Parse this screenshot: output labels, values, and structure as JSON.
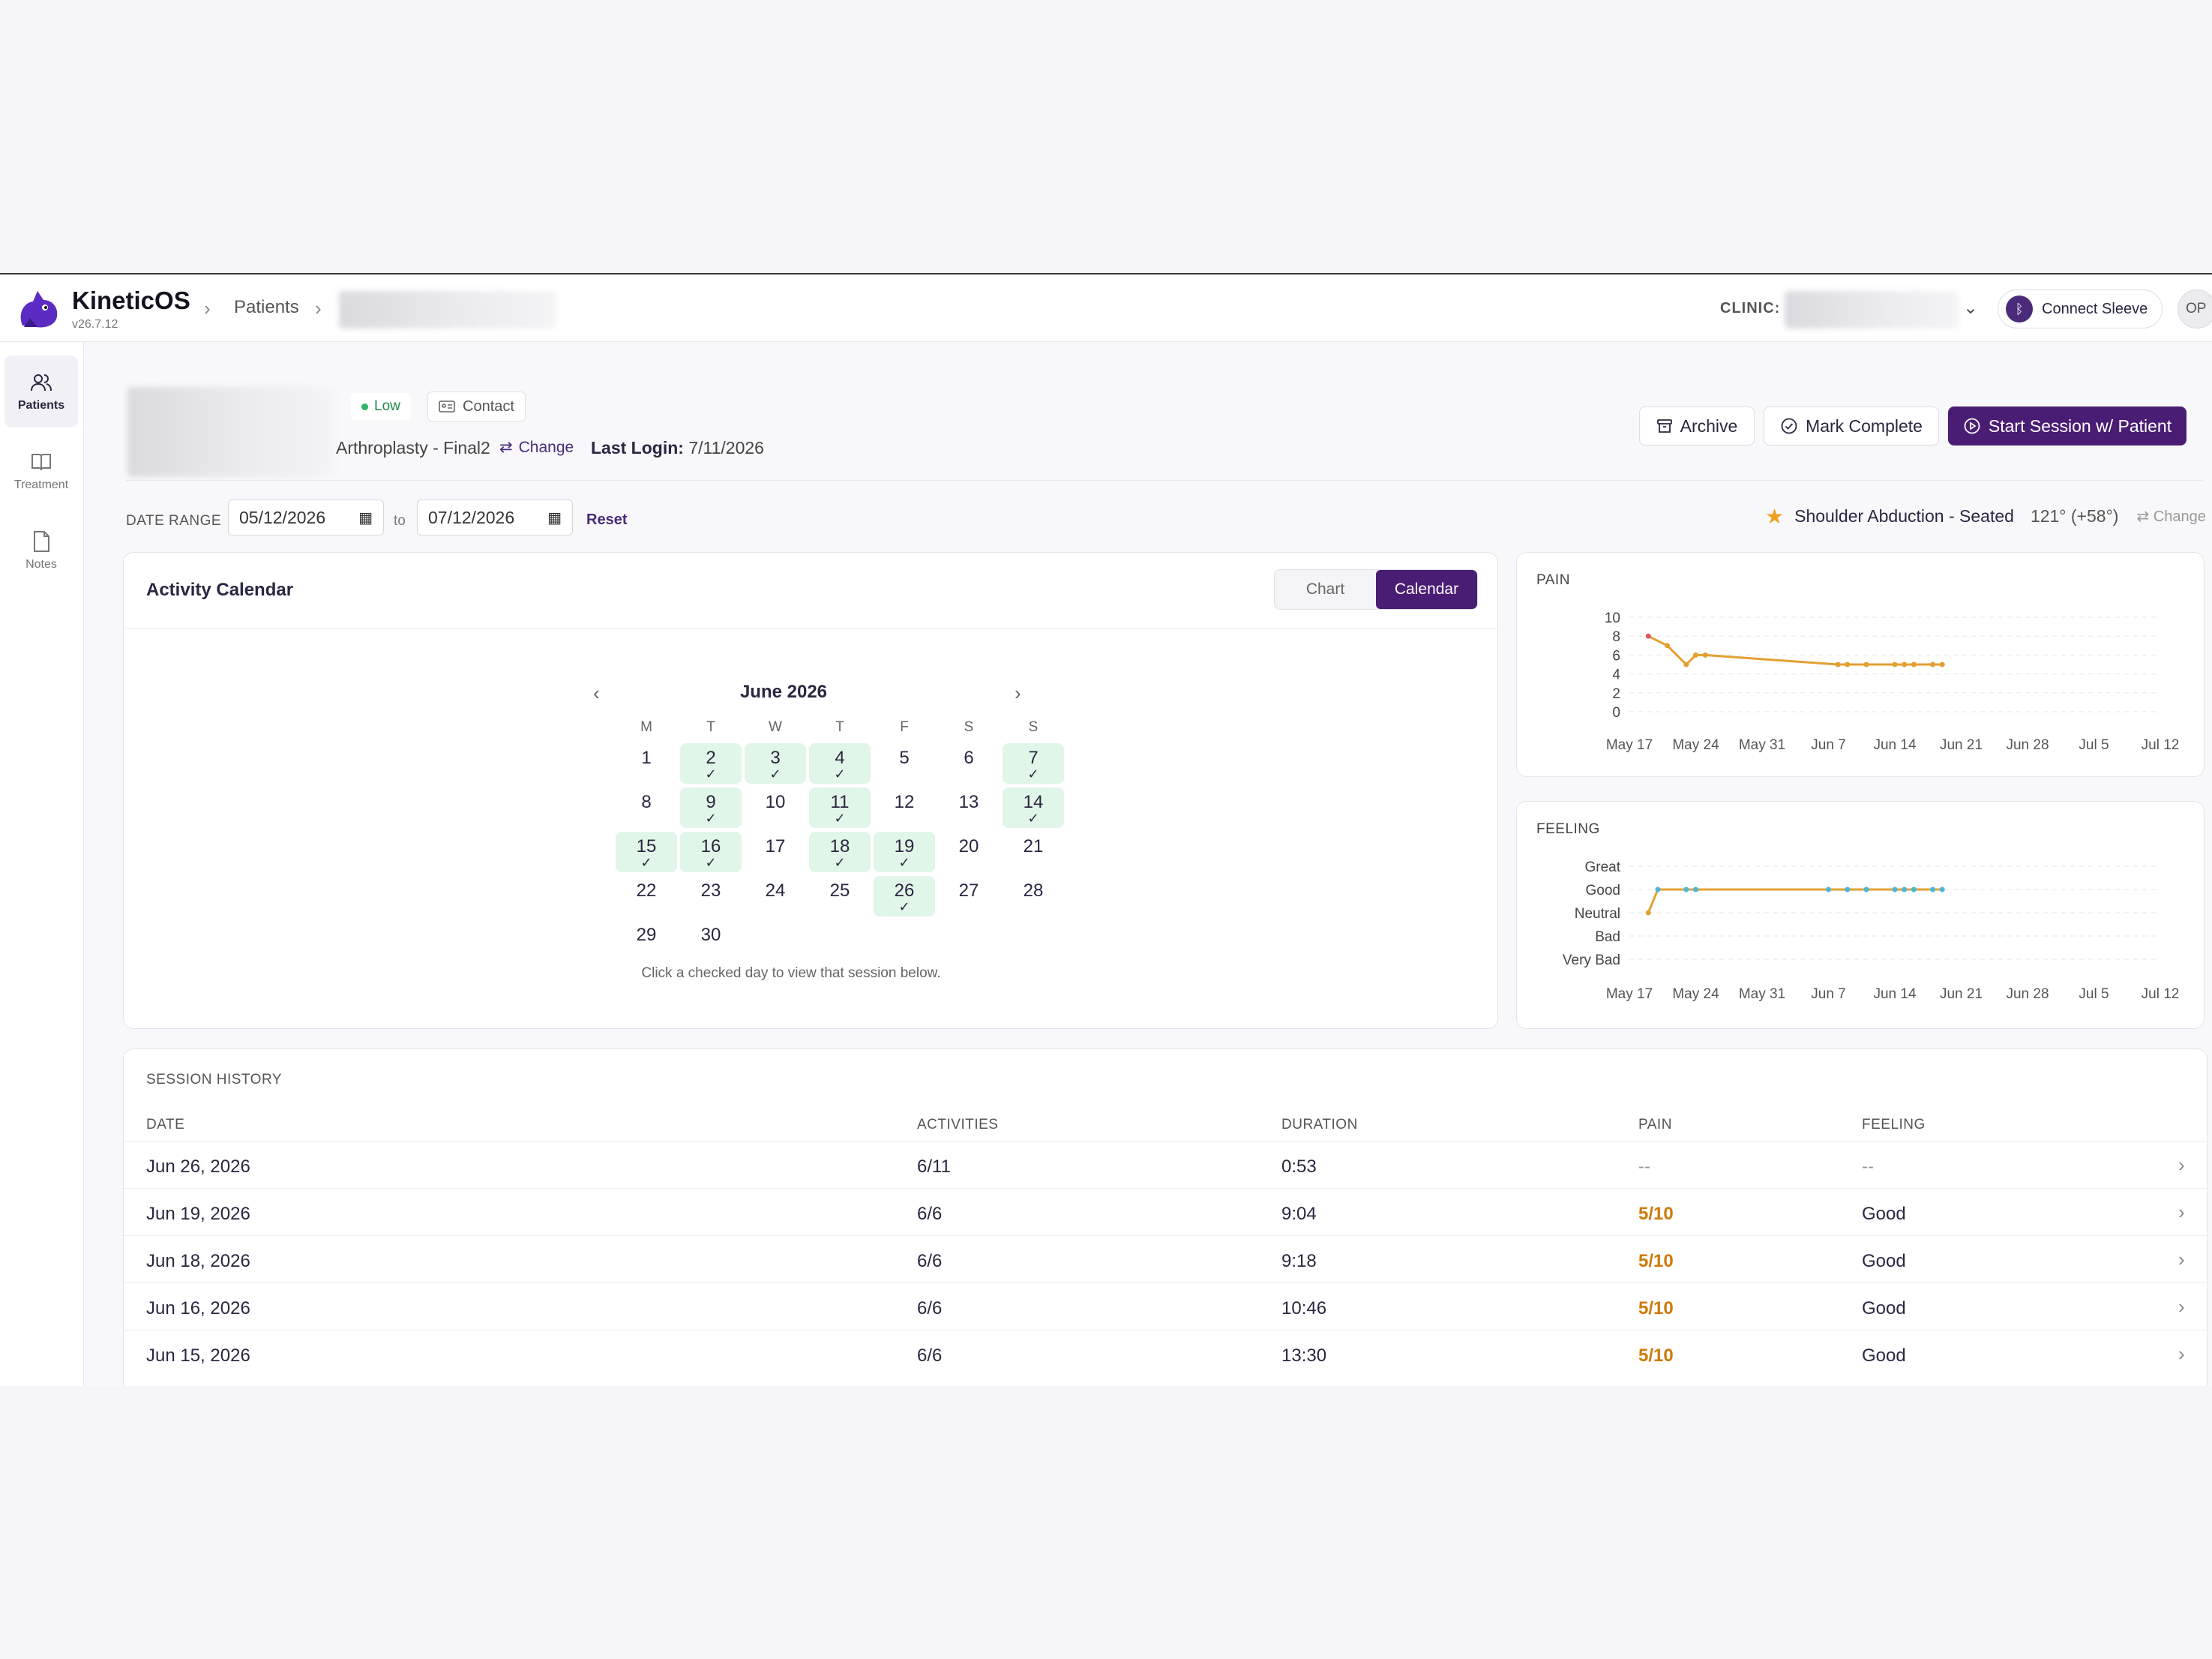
{
  "app": {
    "name": "KineticOS",
    "version": "v26.7.12"
  },
  "breadcrumb": {
    "patients": "Patients"
  },
  "header": {
    "clinic_label": "CLINIC:",
    "connect_label": "Connect Sleeve",
    "avatar_initials": "OP"
  },
  "sidebar": {
    "items": [
      {
        "label": "Patients",
        "icon": "users-icon",
        "active": true
      },
      {
        "label": "Treatment",
        "icon": "book-icon",
        "active": false
      },
      {
        "label": "Notes",
        "icon": "document-icon",
        "active": false
      }
    ]
  },
  "patient": {
    "risk": "Low",
    "contact_label": "Contact",
    "program": "Arthroplasty - Final2",
    "change_label": "Change",
    "last_login_label": "Last Login:",
    "last_login_value": "7/11/2026"
  },
  "actions": {
    "archive": "Archive",
    "mark_complete": "Mark Complete",
    "start_session": "Start Session w/ Patient"
  },
  "date_range": {
    "label": "DATE RANGE",
    "from": "05/12/2026",
    "to_label": "to",
    "to": "07/12/2026",
    "reset": "Reset"
  },
  "favorite_activity": {
    "name": "Shoulder Abduction - Seated",
    "value": "121° (+58°)",
    "change": "Change"
  },
  "calendar": {
    "title": "Activity Calendar",
    "toggle": [
      "Chart",
      "Calendar"
    ],
    "selected_view": "Calendar",
    "month": "June 2026",
    "weekdays": [
      "M",
      "T",
      "W",
      "T",
      "F",
      "S",
      "S"
    ],
    "first_weekday_index": 0,
    "days_in_month": 30,
    "completed_days": [
      2,
      3,
      4,
      7,
      9,
      11,
      14,
      15,
      16,
      18,
      19,
      26
    ],
    "hint": "Click a checked day to view that session below."
  },
  "pain_chart": {
    "title": "PAIN",
    "y_ticks": [
      "10",
      "8",
      "6",
      "4",
      "2",
      "0"
    ],
    "x_ticks": [
      "May 17",
      "May 24",
      "May 31",
      "Jun 7",
      "Jun 14",
      "Jun 21",
      "Jun 28",
      "Jul 5",
      "Jul 12"
    ]
  },
  "feeling_chart": {
    "title": "FEELING",
    "y_ticks": [
      "Great",
      "Good",
      "Neutral",
      "Bad",
      "Very Bad"
    ],
    "x_ticks": [
      "May 17",
      "May 24",
      "May 31",
      "Jun 7",
      "Jun 14",
      "Jun 21",
      "Jun 28",
      "Jul 5",
      "Jul 12"
    ]
  },
  "chart_data": [
    {
      "type": "line",
      "title": "PAIN",
      "ylim": [
        0,
        10
      ],
      "grid": true,
      "x": [
        "May 19",
        "May 21",
        "May 23",
        "May 24",
        "May 25",
        "Jun 8",
        "Jun 9",
        "Jun 11",
        "Jun 14",
        "Jun 15",
        "Jun 16",
        "Jun 18",
        "Jun 19"
      ],
      "series": [
        {
          "values": [
            8,
            7,
            5,
            6,
            6,
            5,
            5,
            5,
            5,
            5,
            5,
            5,
            5
          ]
        }
      ],
      "line_color": "#e3a032",
      "first_point_color": "#e0575b"
    },
    {
      "type": "line",
      "title": "FEELING",
      "y_categories": [
        "Very Bad",
        "Bad",
        "Neutral",
        "Good",
        "Great"
      ],
      "grid": true,
      "x": [
        "May 19",
        "May 20",
        "May 23",
        "May 24",
        "Jun 7",
        "Jun 9",
        "Jun 11",
        "Jun 14",
        "Jun 15",
        "Jun 16",
        "Jun 18",
        "Jun 19"
      ],
      "series": [
        {
          "values": [
            "Neutral",
            "Good",
            "Good",
            "Good",
            "Good",
            "Good",
            "Good",
            "Good",
            "Good",
            "Good",
            "Good",
            "Good"
          ]
        }
      ],
      "line_color": "#e3a032",
      "point_color": "#4bb6d8"
    }
  ],
  "session_history": {
    "title": "SESSION HISTORY",
    "columns": [
      "DATE",
      "ACTIVITIES",
      "DURATION",
      "PAIN",
      "FEELING"
    ],
    "rows": [
      {
        "date": "Jun 26, 2026",
        "activities": "6/11",
        "duration": "0:53",
        "pain": "--",
        "feeling": "--"
      },
      {
        "date": "Jun 19, 2026",
        "activities": "6/6",
        "duration": "9:04",
        "pain": "5/10",
        "feeling": "Good"
      },
      {
        "date": "Jun 18, 2026",
        "activities": "6/6",
        "duration": "9:18",
        "pain": "5/10",
        "feeling": "Good"
      },
      {
        "date": "Jun 16, 2026",
        "activities": "6/6",
        "duration": "10:46",
        "pain": "5/10",
        "feeling": "Good"
      },
      {
        "date": "Jun 15, 2026",
        "activities": "6/6",
        "duration": "13:30",
        "pain": "5/10",
        "feeling": "Good"
      }
    ]
  },
  "colors": {
    "brand": "#4a1d74",
    "completed_day": "#e0f6e8",
    "pain_value": "#d07a0a"
  }
}
